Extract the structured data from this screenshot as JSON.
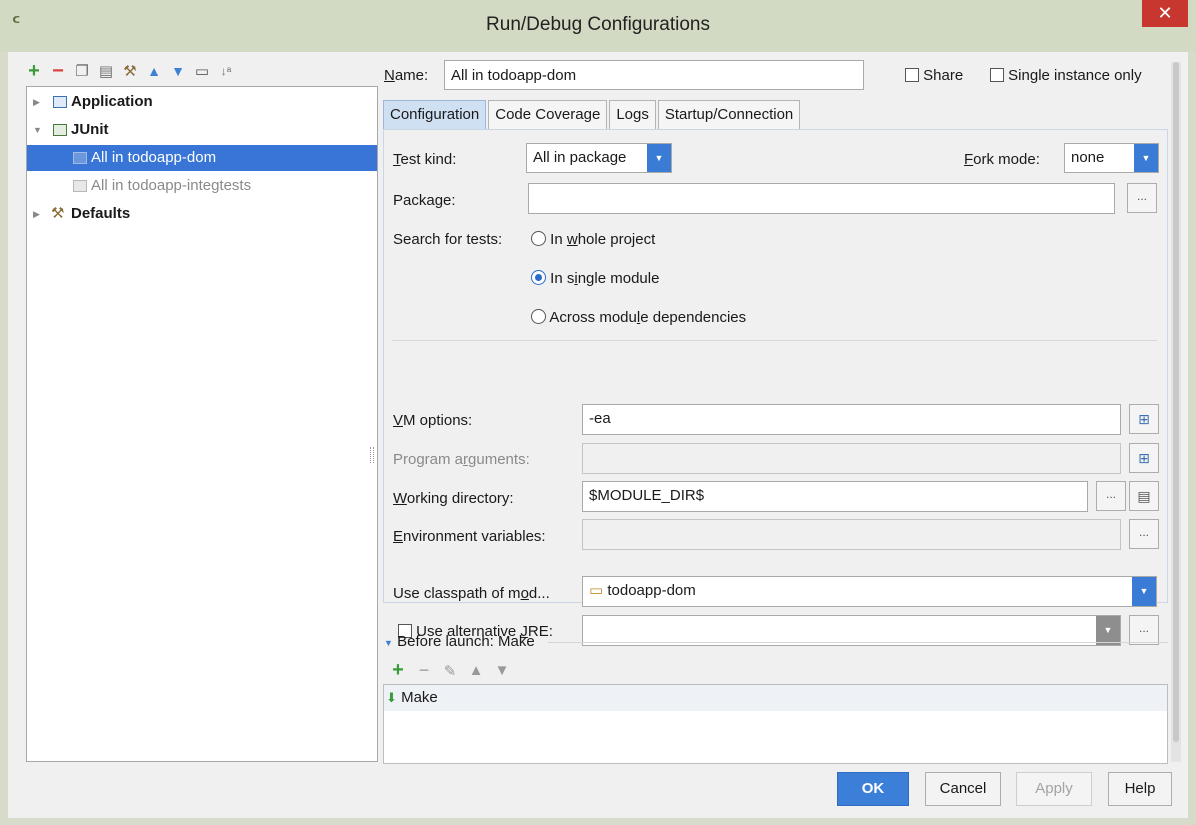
{
  "window": {
    "title": "Run/Debug Configurations",
    "close_glyph": "✕"
  },
  "tree_toolbar": [
    "add-icon",
    "remove-icon",
    "copy-icon",
    "save-icon",
    "edit-defaults-icon",
    "move-up-icon",
    "move-down-icon",
    "folder-icon",
    "sort-icon"
  ],
  "tree": {
    "items": [
      {
        "label": "Application",
        "bold": true,
        "expanded": false
      },
      {
        "label": "JUnit",
        "bold": true,
        "expanded": true
      },
      {
        "label": "All in todoapp-dom",
        "selected": true
      },
      {
        "label": "All in todoapp-integtests",
        "disabled": true
      },
      {
        "label": "Defaults",
        "bold": true,
        "expanded": false
      }
    ]
  },
  "header": {
    "name_label": "Name:",
    "name_value": "All in todoapp-dom",
    "share_label": "Share",
    "single_instance_label": "Single instance only"
  },
  "tabs": [
    "Configuration",
    "Code Coverage",
    "Logs",
    "Startup/Connection"
  ],
  "config": {
    "test_kind_label": "Test kind:",
    "test_kind_value": "All in package",
    "fork_mode_label": "Fork mode:",
    "fork_mode_value": "none",
    "package_label": "Package:",
    "package_value": "",
    "search_label": "Search for tests:",
    "search_options": [
      "In whole project",
      "In single module",
      "Across module dependencies"
    ],
    "search_selected": "In single module",
    "vm_options_label": "VM options:",
    "vm_options_value": "-ea",
    "program_args_label": "Program arguments:",
    "program_args_value": "",
    "working_dir_label": "Working directory:",
    "working_dir_value": "$MODULE_DIR$",
    "env_vars_label": "Environment variables:",
    "env_vars_value": "",
    "classpath_label": "Use classpath of mod...",
    "classpath_value": "todoapp-dom",
    "alt_jre_label": "Use alternative JRE:",
    "alt_jre_value": "",
    "ellipsis": "..."
  },
  "before_launch": {
    "title": "Before launch: Make",
    "items": [
      "Make"
    ]
  },
  "buttons": {
    "ok": "OK",
    "cancel": "Cancel",
    "apply": "Apply",
    "help": "Help"
  },
  "colors": {
    "selection": "#3875d7",
    "accent": "#3b7fd9",
    "add": "#3a9b3a",
    "remove": "#d9413a"
  }
}
